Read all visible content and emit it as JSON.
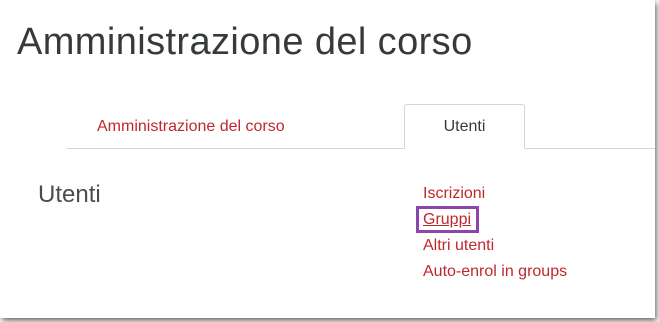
{
  "page": {
    "title": "Amministrazione del corso"
  },
  "tabs": [
    {
      "label": "Amministrazione del corso",
      "active": false
    },
    {
      "label": "Utenti",
      "active": true
    }
  ],
  "section": {
    "heading": "Utenti",
    "links": [
      {
        "label": "Iscrizioni",
        "highlighted": false
      },
      {
        "label": "Gruppi",
        "highlighted": true
      },
      {
        "label": "Altri utenti",
        "highlighted": false
      },
      {
        "label": "Auto-enrol in groups",
        "highlighted": false
      }
    ]
  },
  "colors": {
    "link": "#c0272d",
    "text": "#373a3c",
    "highlight_box": "#8e44ad",
    "tab_border": "#d5d5d5"
  }
}
